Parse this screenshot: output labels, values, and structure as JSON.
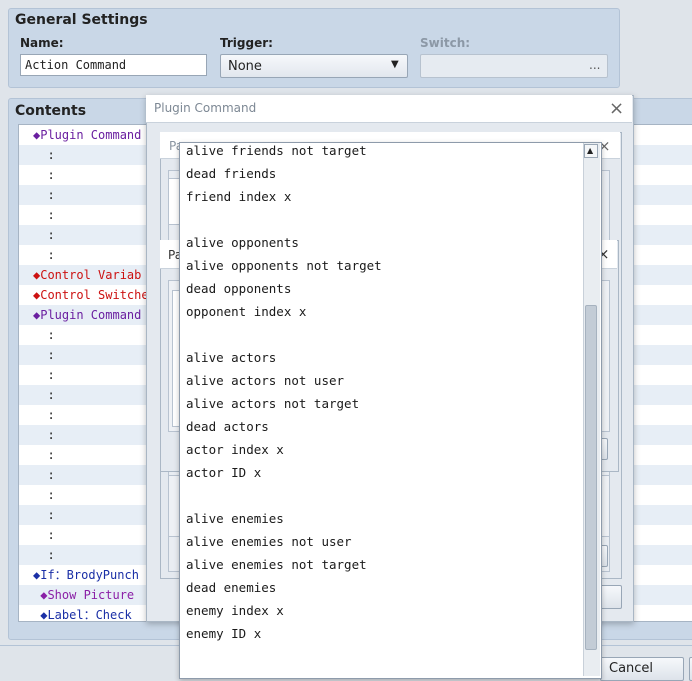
{
  "general_settings": {
    "title": "General Settings",
    "name_label": "Name:",
    "name_value": "Action Command",
    "trigger_label": "Trigger:",
    "trigger_value": "None",
    "switch_label": "Switch:",
    "switch_button": "..."
  },
  "contents": {
    "title": "Contents",
    "rows": [
      {
        "text": "◆Plugin Command",
        "color": "#6a1fa0"
      },
      {
        "text": "  :",
        "color": "#222"
      },
      {
        "text": "  :",
        "color": "#222"
      },
      {
        "text": "  :",
        "color": "#222"
      },
      {
        "text": "  :",
        "color": "#222"
      },
      {
        "text": "  :",
        "color": "#222"
      },
      {
        "text": "  :",
        "color": "#222"
      },
      {
        "text": "◆Control Variab",
        "color": "#cc1111"
      },
      {
        "text": "◆Control Switche",
        "color": "#cc1111"
      },
      {
        "text": "◆Plugin Command",
        "color": "#6a1fa0"
      },
      {
        "text": "  :",
        "color": "#222"
      },
      {
        "text": "  :",
        "color": "#222"
      },
      {
        "text": "  :",
        "color": "#222"
      },
      {
        "text": "  :",
        "color": "#222"
      },
      {
        "text": "  :",
        "color": "#222"
      },
      {
        "text": "  :",
        "color": "#222"
      },
      {
        "text": "  :",
        "color": "#222"
      },
      {
        "text": "  :",
        "color": "#222"
      },
      {
        "text": "  :",
        "color": "#222"
      },
      {
        "text": "  :",
        "color": "#222"
      },
      {
        "text": "  :",
        "color": "#222"
      },
      {
        "text": "  :",
        "color": "#222"
      },
      {
        "text": "◆If：BrodyPunch",
        "color": "#1a2fa6"
      },
      {
        "text": " ◆Show Picture",
        "color": "#8a1fa6"
      },
      {
        "text": " ◆Label：Check",
        "color": "#1a2fa6"
      }
    ]
  },
  "plugin_dialog": {
    "title": "Plugin Command",
    "close_icon": "×",
    "inner_tab_1": "Pa",
    "inner_tab_2": "Pa"
  },
  "dropdown": {
    "options": [
      "alive friends not target",
      "dead friends",
      "friend index x",
      "",
      "alive opponents",
      "alive opponents not target",
      "dead opponents",
      "opponent index x",
      "",
      "alive actors",
      "alive actors not user",
      "alive actors not target",
      "dead actors",
      "actor index x",
      "actor ID x",
      "",
      "alive enemies",
      "alive enemies not user",
      "alive enemies not target",
      "dead enemies",
      "enemy index x",
      "enemy ID x"
    ]
  },
  "footer": {
    "cancel_label": "Cancel"
  }
}
